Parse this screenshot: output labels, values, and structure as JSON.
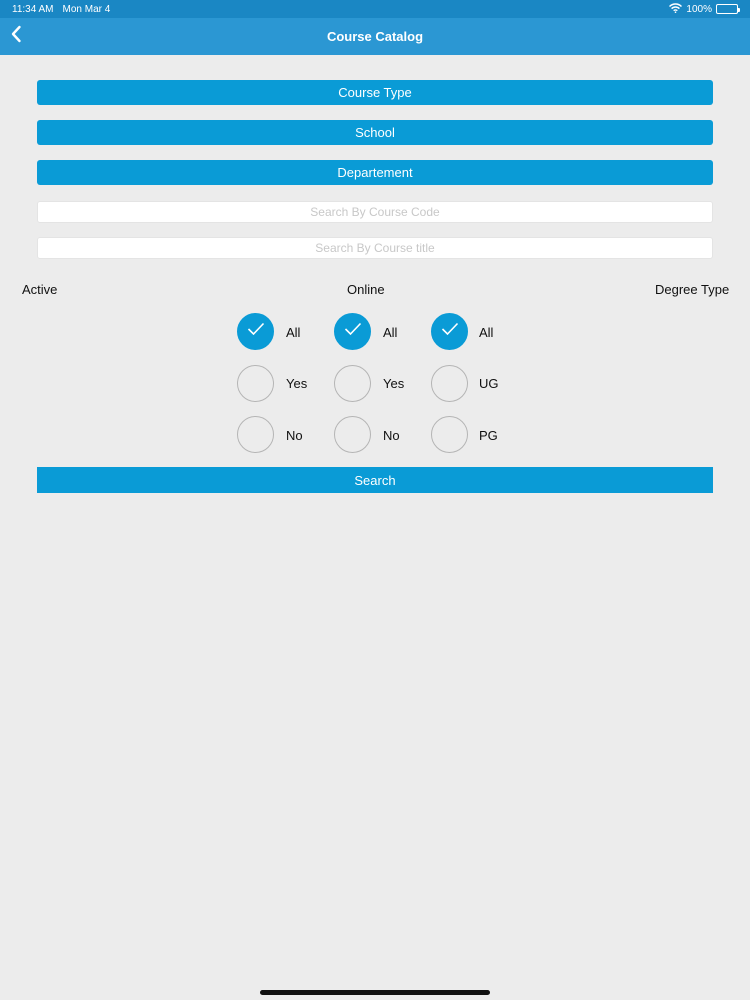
{
  "status_bar": {
    "time": "11:34 AM",
    "date": "Mon Mar 4",
    "battery": "100%"
  },
  "nav": {
    "title": "Course Catalog"
  },
  "filters": {
    "course_type": "Course Type",
    "school": "School",
    "department": "Departement"
  },
  "search": {
    "code_placeholder": "Search By Course Code",
    "title_placeholder": "Search By Course title"
  },
  "groups": {
    "active": {
      "label": "Active",
      "options": [
        "All",
        "Yes",
        "No"
      ],
      "selected": "All"
    },
    "online": {
      "label": "Online",
      "options": [
        "All",
        "Yes",
        "No"
      ],
      "selected": "All"
    },
    "degree_type": {
      "label": "Degree Type",
      "options": [
        "All",
        "UG",
        "PG"
      ],
      "selected": "All"
    }
  },
  "search_button": "Search",
  "colors": {
    "accent": "#0a9bd6",
    "nav": "#2b97d3",
    "status": "#1a87c4",
    "background": "#ececec"
  }
}
